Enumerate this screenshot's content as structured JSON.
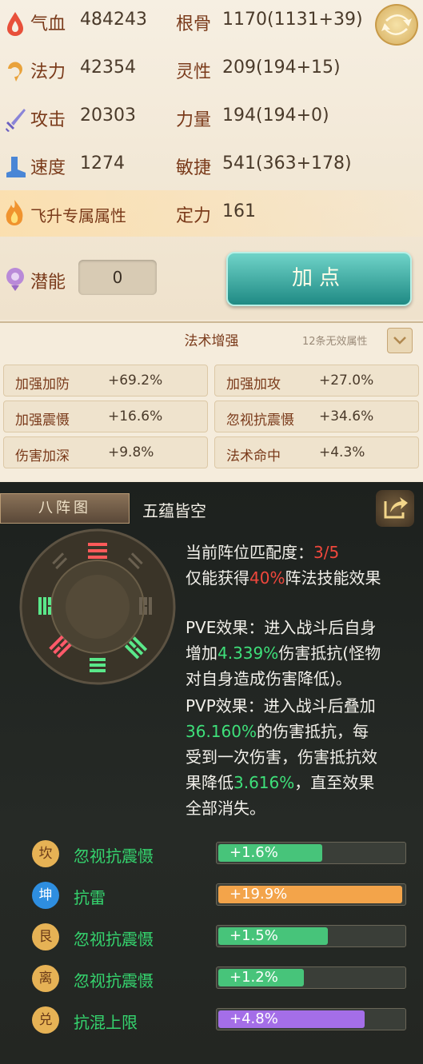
{
  "stats": {
    "left": [
      {
        "icon": "blood-drop-icon",
        "label": "气血",
        "value": "484243"
      },
      {
        "icon": "magic-swirl-icon",
        "label": "法力",
        "value": "42354"
      },
      {
        "icon": "sword-icon",
        "label": "攻击",
        "value": "20303"
      },
      {
        "icon": "boot-icon",
        "label": "速度",
        "value": "1274"
      }
    ],
    "right": [
      {
        "label": "根骨",
        "value": "1170(1131+39)"
      },
      {
        "label": "灵性",
        "value": "209(194+15)"
      },
      {
        "label": "力量",
        "value": "194(194+0)"
      },
      {
        "label": "敏捷",
        "value": "541(363+178)"
      }
    ],
    "feisheng_label": "飞升专属属性",
    "dingli_label": "定力",
    "dingli_value": "161",
    "potential_label": "潜能",
    "potential_value": "0",
    "add_point_label": "加点"
  },
  "magic": {
    "title": "法术增强",
    "note": "12条无效属性",
    "items": [
      {
        "label": "加强加防",
        "value": "+69.2%"
      },
      {
        "label": "加强加攻",
        "value": "+27.0%"
      },
      {
        "label": "加强震慑",
        "value": "+16.6%"
      },
      {
        "label": "忽视抗震慑",
        "value": "+34.6%"
      },
      {
        "label": "伤害加深",
        "value": "+9.8%"
      },
      {
        "label": "法术命中",
        "value": "+4.3%"
      }
    ]
  },
  "formation": {
    "tab_label": "八阵图",
    "name": "五蕴皆空",
    "match_prefix": "当前阵位匹配度：",
    "match_value": "3/5",
    "effect_prefix": "仅能获得",
    "effect_percent": "40%",
    "effect_suffix": "阵法技能效果",
    "pve_line1": "PVE效果：进入战斗后自身",
    "pve_line2_prefix": "增加",
    "pve_value": "4.339%",
    "pve_line2_suffix": "伤害抵抗(怪物",
    "pve_line3": "对自身造成伤害降低)。",
    "pvp_line1": "PVP效果：进入战斗后叠加",
    "pvp_value": "36.160%",
    "pvp_line2_suffix": "的伤害抵抗，每",
    "pvp_line3": "受到一次伤害，伤害抵抗效",
    "pvp_line4_prefix": "果降低",
    "pvp_value2": "3.616%",
    "pvp_line4_suffix": "，直至效果",
    "pvp_line5": "全部消失。",
    "bonuses": [
      {
        "icon_char": "坎",
        "label": "忽视抗震慑",
        "value": "+1.6%",
        "fill": 0.56,
        "color": "#47c47a",
        "icon_bg": "#e6b255"
      },
      {
        "icon_char": "坤",
        "label": "抗雷",
        "value": "+19.9%",
        "fill": 0.99,
        "color": "#f3a44a",
        "icon_bg": "#2e8ee0"
      },
      {
        "icon_char": "艮",
        "label": "忽视抗震慑",
        "value": "+1.5%",
        "fill": 0.59,
        "color": "#47c47a",
        "icon_bg": "#e6b255"
      },
      {
        "icon_char": "离",
        "label": "忽视抗震慑",
        "value": "+1.2%",
        "fill": 0.46,
        "color": "#47c47a",
        "icon_bg": "#e6b255"
      },
      {
        "icon_char": "兑",
        "label": "抗混上限",
        "value": "+4.8%",
        "fill": 0.79,
        "color": "#a46ee8",
        "icon_bg": "#e6b255"
      }
    ]
  }
}
